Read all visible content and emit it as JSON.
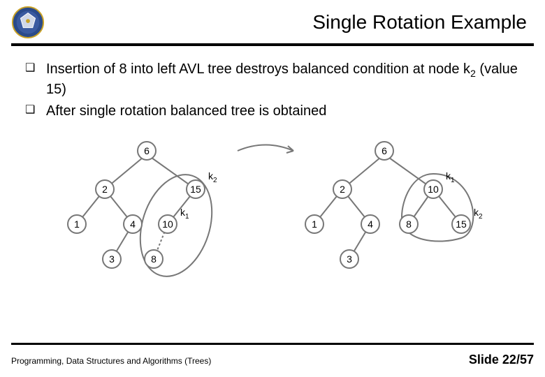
{
  "header": {
    "title": "Single Rotation Example"
  },
  "bullets": [
    {
      "pre": "Insertion of 8 into left AVL tree destroys balanced condition at node k",
      "sub": "2",
      "post": " (value 15)"
    },
    {
      "pre": "After single rotation balanced tree is obtained",
      "sub": "",
      "post": ""
    }
  ],
  "diagram": {
    "labels": {
      "k1": "k",
      "k1sub": "1",
      "k2": "k",
      "k2sub": "2"
    },
    "left_tree": {
      "nodes": [
        {
          "id": "L6",
          "v": "6"
        },
        {
          "id": "L2",
          "v": "2"
        },
        {
          "id": "L15",
          "v": "15"
        },
        {
          "id": "L1",
          "v": "1"
        },
        {
          "id": "L4",
          "v": "4"
        },
        {
          "id": "L10",
          "v": "10"
        },
        {
          "id": "L3",
          "v": "3"
        },
        {
          "id": "L8",
          "v": "8"
        }
      ]
    },
    "right_tree": {
      "nodes": [
        {
          "id": "R6",
          "v": "6"
        },
        {
          "id": "R2",
          "v": "2"
        },
        {
          "id": "R10",
          "v": "10"
        },
        {
          "id": "R1",
          "v": "1"
        },
        {
          "id": "R4",
          "v": "4"
        },
        {
          "id": "R8",
          "v": "8"
        },
        {
          "id": "R15",
          "v": "15"
        },
        {
          "id": "R3",
          "v": "3"
        }
      ]
    }
  },
  "footer": {
    "left": "Programming, Data Structures and Algorithms (Trees)",
    "right_prefix": "Slide ",
    "page": "22",
    "sep": "/",
    "total": "57"
  }
}
